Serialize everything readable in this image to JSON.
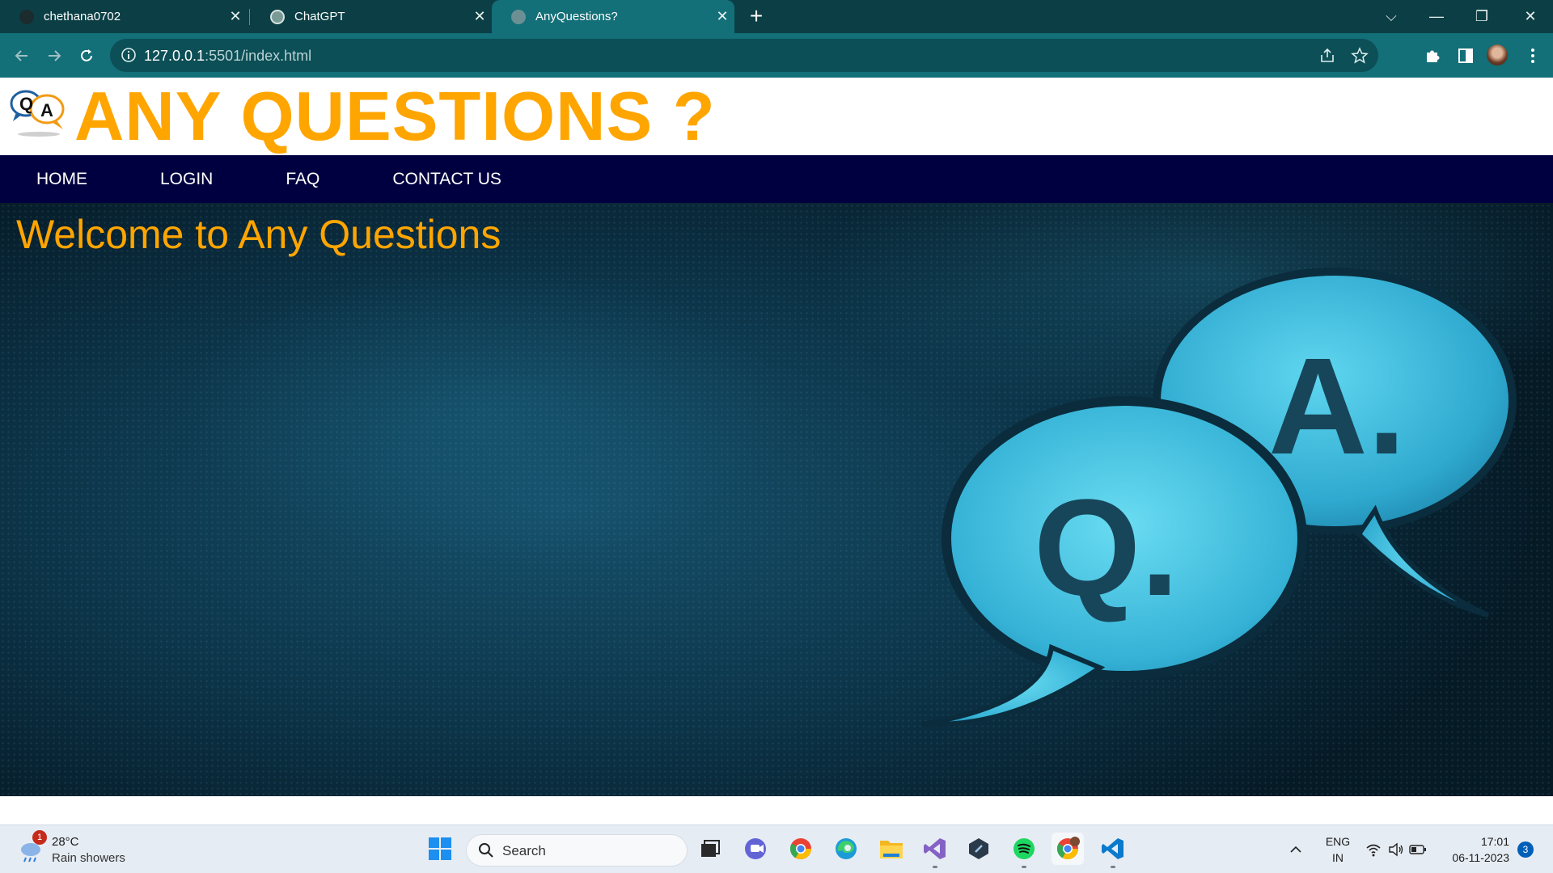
{
  "browser": {
    "tabs": [
      {
        "title": "chethana0702",
        "favicon": "github-icon",
        "active": false
      },
      {
        "title": "ChatGPT",
        "favicon": "chatgpt-icon",
        "active": false
      },
      {
        "title": "AnyQuestions?",
        "favicon": "globe-icon",
        "active": true
      }
    ],
    "url_host": "127.0.0.1",
    "url_rest": ":5501/index.html",
    "colors": {
      "frame": "#0b3f45",
      "toolbar": "#136f78",
      "omnibox": "#0c4f56"
    }
  },
  "site": {
    "title": "ANY QUESTIONS ?",
    "logo_text_q": "Q",
    "logo_text_a": "A",
    "nav": [
      "HOME",
      "LOGIN",
      "FAQ",
      "CONTACT US"
    ],
    "welcome": "Welcome to Any Questions",
    "hero_letters": {
      "q": "Q.",
      "a": "A."
    },
    "colors": {
      "accent": "#ffa500",
      "nav_bg": "#000040",
      "bubble": "#3fc0e0"
    }
  },
  "taskbar": {
    "weather_temp": "28°C",
    "weather_cond": "Rain showers",
    "weather_badge": "1",
    "search_label": "Search",
    "apps": [
      "start-icon",
      "task-view-icon",
      "teams-icon",
      "chrome-icon",
      "edge-icon",
      "file-explorer-icon",
      "visual-studio-icon",
      "app-icon",
      "spotify-icon",
      "chrome-profile-icon",
      "vscode-icon"
    ],
    "lang_top": "ENG",
    "lang_bottom": "IN",
    "time": "17:01",
    "date": "06-11-2023",
    "notifications": "3"
  }
}
